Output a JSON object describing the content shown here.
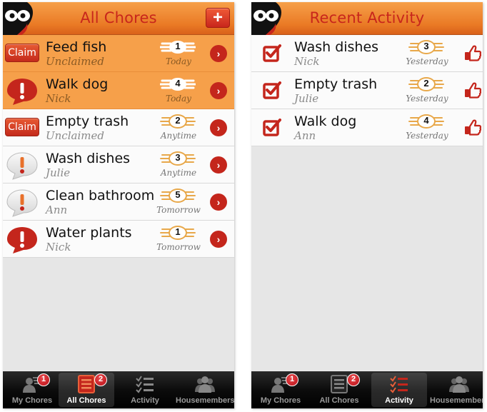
{
  "colors": {
    "accent_red": "#c4261c",
    "header_orange": "#ea7a25",
    "highlight_row": "#f6a04a",
    "title_red": "#c8261c",
    "badge_gold": "#e8a84a"
  },
  "left_screen": {
    "header": {
      "title": "All Chores",
      "logo_icon": "owl-logo-icon",
      "add_label": "+"
    },
    "chores": [
      {
        "name": "Feed fish",
        "assignee": "Unclaimed",
        "points": "1",
        "due": "Today",
        "status": "claim",
        "claim_label": "Claim",
        "highlighted": true
      },
      {
        "name": "Walk dog",
        "assignee": "Nick",
        "points": "4",
        "due": "Today",
        "status": "alert-red",
        "highlighted": true
      },
      {
        "name": "Empty trash",
        "assignee": "Unclaimed",
        "points": "2",
        "due": "Anytime",
        "status": "claim",
        "claim_label": "Claim",
        "highlighted": false
      },
      {
        "name": "Wash dishes",
        "assignee": "Julie",
        "points": "3",
        "due": "Anytime",
        "status": "alert-gray",
        "highlighted": false
      },
      {
        "name": "Clean bathroom",
        "assignee": "Ann",
        "points": "5",
        "due": "Tomorrow",
        "status": "alert-gray",
        "highlighted": false
      },
      {
        "name": "Water plants",
        "assignee": "Nick",
        "points": "1",
        "due": "Tomorrow",
        "status": "alert-red",
        "highlighted": false
      }
    ],
    "tabs": [
      {
        "label": "My Chores",
        "icon": "person-icon",
        "count": "1",
        "active": false
      },
      {
        "label": "All Chores",
        "icon": "list-icon",
        "count": "2",
        "active": true
      },
      {
        "label": "Activity",
        "icon": "checklist-icon",
        "count": null,
        "active": false
      },
      {
        "label": "Housemembers",
        "icon": "group-icon",
        "count": null,
        "active": false
      }
    ]
  },
  "right_screen": {
    "header": {
      "title": "Recent Activity",
      "logo_icon": "owl-logo-icon"
    },
    "activities": [
      {
        "name": "Wash dishes",
        "who": "Nick",
        "points": "3",
        "when": "Yesterday"
      },
      {
        "name": "Empty trash",
        "who": "Julie",
        "points": "2",
        "when": "Yesterday"
      },
      {
        "name": "Walk dog",
        "who": "Ann",
        "points": "4",
        "when": "Yesterday"
      }
    ],
    "tabs": [
      {
        "label": "My Chores",
        "icon": "person-icon",
        "count": "1",
        "active": false
      },
      {
        "label": "All Chores",
        "icon": "list-icon",
        "count": "2",
        "active": false
      },
      {
        "label": "Activity",
        "icon": "checklist-icon",
        "count": null,
        "active": true
      },
      {
        "label": "Housemembers",
        "icon": "group-icon",
        "count": null,
        "active": false
      }
    ]
  }
}
